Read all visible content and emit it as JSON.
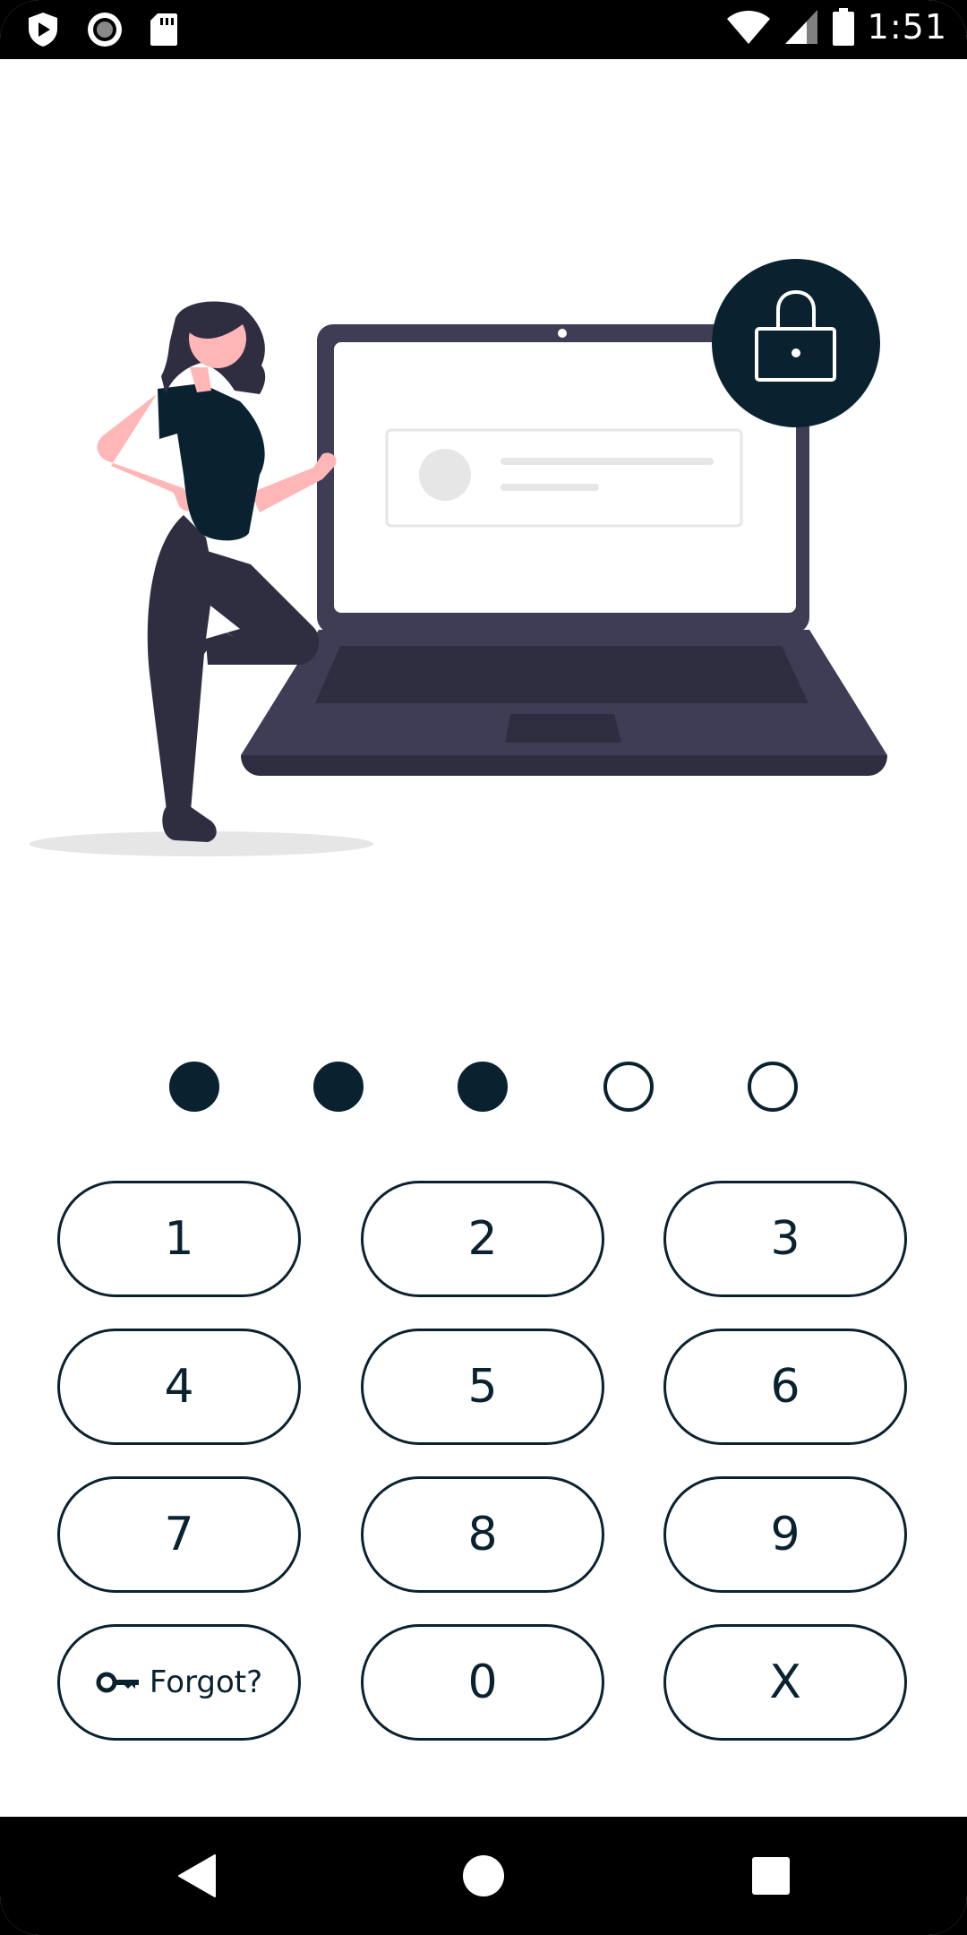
{
  "status_bar": {
    "time": "1:51",
    "icons": [
      "play-protect-icon",
      "record-icon",
      "sd-card-icon",
      "wifi-icon",
      "signal-icon",
      "battery-icon"
    ]
  },
  "pin": {
    "length": 5,
    "entered": 3
  },
  "keypad": {
    "keys": [
      {
        "label": "1"
      },
      {
        "label": "2"
      },
      {
        "label": "3"
      },
      {
        "label": "4"
      },
      {
        "label": "5"
      },
      {
        "label": "6"
      },
      {
        "label": "7"
      },
      {
        "label": "8"
      },
      {
        "label": "9"
      },
      {
        "label": "Forgot?",
        "icon": "key-icon"
      },
      {
        "label": "0"
      },
      {
        "label": "X"
      }
    ]
  },
  "nav_bar": {
    "icons": [
      "back-icon",
      "home-icon",
      "recents-icon"
    ]
  },
  "colors": {
    "accent": "#0a2230",
    "laptop": "#3f3d56",
    "skin": "#ffb6b6",
    "background": "#ffffff"
  }
}
